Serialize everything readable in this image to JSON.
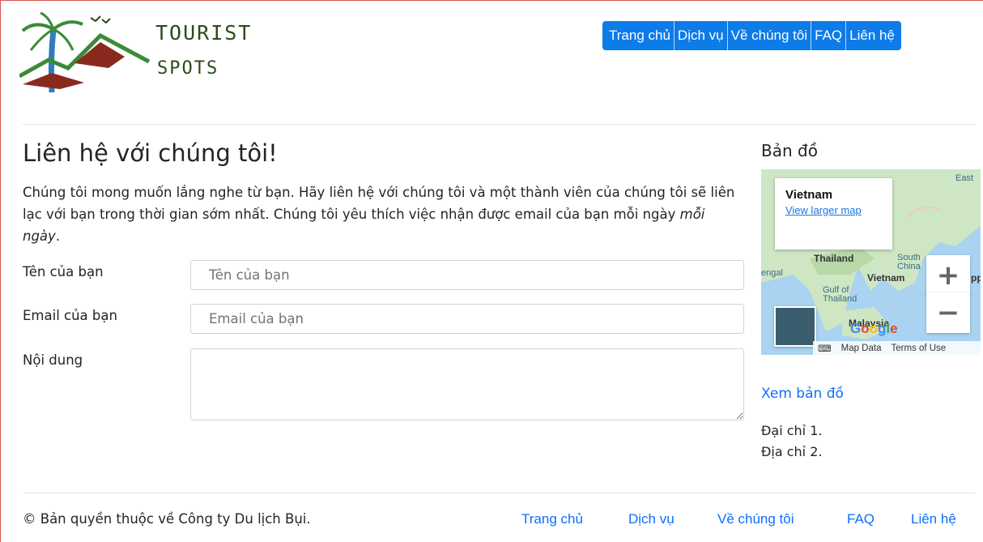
{
  "header": {
    "logo_line1": "TOURIST",
    "logo_line2": "SPOTS",
    "nav": [
      "Trang chủ",
      "Dịch vụ",
      "Về chúng tôi",
      "FAQ",
      "Liên hệ"
    ]
  },
  "main": {
    "title": "Liên hệ với chúng tôi!",
    "intro_text": "Chúng tôi mong muốn lắng nghe từ bạn. Hãy liên hệ với chúng tôi và một thành viên của chúng tôi sẽ liên lạc với bạn trong thời gian sớm nhất. Chúng tôi yêu thích việc nhận được email của bạn mỗi ngày ",
    "intro_em": "mỗi ngày",
    "intro_end": ".",
    "form": {
      "name_label": "Tên của bạn",
      "name_placeholder": "Tên của bạn",
      "email_label": "Email của bạn",
      "email_placeholder": "Email của bạn",
      "content_label": "Nội dung"
    }
  },
  "sidebar": {
    "heading": "Bản đồ",
    "map": {
      "place": "Vietnam",
      "view_larger": "View larger map",
      "labels": [
        "Thailand",
        "Vietnam",
        "Gulf of Thailand",
        "South China",
        "Malaysia",
        "engal",
        "East",
        "pp"
      ],
      "zoom_in": "+",
      "zoom_out": "−",
      "attribution": [
        "Map Data",
        "Terms of Use"
      ],
      "google_logo": "Google"
    },
    "link": "Xem bản đồ",
    "address1": "Đại chỉ 1.",
    "address2": "Địa chỉ 2."
  },
  "footer": {
    "copyright": "© Bản quyền thuộc về Công ty Du lịch Bụi.",
    "links": [
      "Trang chủ",
      "Dịch vụ",
      "Về chúng tôi",
      "FAQ",
      "Liên hệ"
    ]
  },
  "colors": {
    "accent": "#0d7be8",
    "link": "#0d6efd"
  }
}
